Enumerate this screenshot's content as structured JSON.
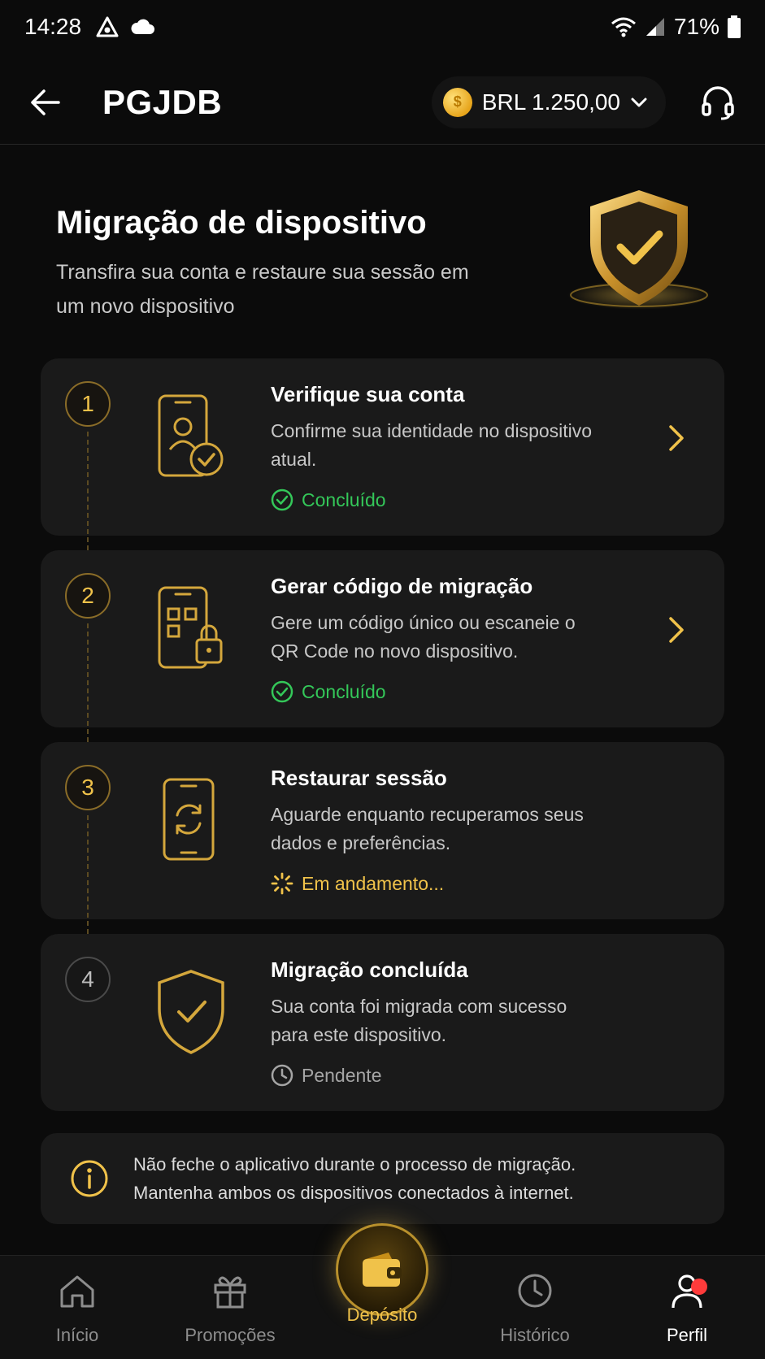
{
  "status_bar": {
    "time": "14:28",
    "battery": "71%"
  },
  "header": {
    "title": "PGJDB",
    "balance": "BRL 1.250,00"
  },
  "hero": {
    "title": "Migração de dispositivo",
    "subtitle": "Transfira sua conta e restaure sua sessão em um novo dispositivo"
  },
  "steps": [
    {
      "number": "1",
      "title": "Verifique sua conta",
      "desc": "Confirme sua identidade no dispositivo atual.",
      "status": "Concluído",
      "state": "done",
      "icon": "phone-user-check-icon"
    },
    {
      "number": "2",
      "title": "Gerar código de migração",
      "desc": "Gere um código único ou escaneie o QR Code no novo dispositivo.",
      "status": "Concluído",
      "state": "done",
      "icon": "phone-qr-lock-icon"
    },
    {
      "number": "3",
      "title": "Restaurar sessão",
      "desc": "Aguarde enquanto recuperamos seus dados e preferências.",
      "status": "Em andamento...",
      "state": "in-progress",
      "icon": "phone-sync-icon"
    },
    {
      "number": "4",
      "title": "Migração concluída",
      "desc": "Sua conta foi migrada com sucesso para este dispositivo.",
      "status": "Pendente",
      "state": "pending",
      "icon": "shield-check-icon"
    }
  ],
  "info": {
    "line1": "Não feche o aplicativo durante o processo de migração.",
    "line2": "Mantenha ambos os dispositivos conectados à internet."
  },
  "nav": [
    {
      "label": "Início",
      "icon": "home-icon"
    },
    {
      "label": "Promoções",
      "icon": "gift-icon"
    },
    {
      "label": "Depósito",
      "icon": "wallet-icon",
      "active": true
    },
    {
      "label": "Histórico",
      "icon": "clock-icon"
    },
    {
      "label": "Perfil",
      "icon": "user-icon",
      "badge": true
    }
  ],
  "colors": {
    "accent": "#f0c24a",
    "success": "#34c759",
    "background": "#0b0b0b",
    "card": "#1a1a1a"
  }
}
